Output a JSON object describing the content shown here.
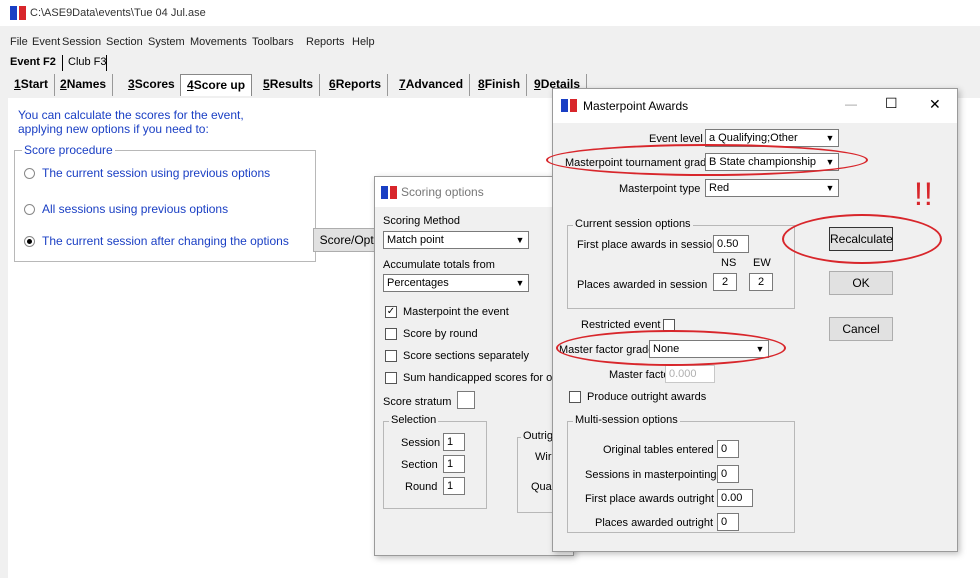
{
  "app": {
    "title": "C:\\ASE9Data\\events\\Tue 04 Jul.ase",
    "menu": [
      "File",
      "Event",
      "Session",
      "Section",
      "System",
      "Movements",
      "Toolbars",
      "Reports",
      "Help"
    ],
    "event_tabs": [
      "Event F2",
      "Club F3"
    ],
    "tabs": [
      {
        "key": "1",
        "label": "Start"
      },
      {
        "key": "2",
        "label": "Names"
      },
      {
        "key": "3",
        "label": "Scores"
      },
      {
        "key": "4",
        "label": "Score up"
      },
      {
        "key": "5",
        "label": "Results"
      },
      {
        "key": "6",
        "label": "Reports"
      },
      {
        "key": "7",
        "label": "Advanced"
      },
      {
        "key": "8",
        "label": "Finish"
      },
      {
        "key": "9",
        "label": "Details"
      }
    ],
    "intro_line1": "You can calculate the scores for the event,",
    "intro_line2": "applying new options if you need to:",
    "procedure_label": "Score procedure",
    "options": [
      "The current session using previous options",
      "All  sessions using previous options",
      "The current session after changing the options"
    ],
    "score_button": "Score/Opti"
  },
  "scoring": {
    "title": "Scoring options",
    "method_label": "Scoring Method",
    "method_value": "Match point",
    "accumulate_label": "Accumulate totals from",
    "accumulate_value": "Percentages",
    "checks": [
      {
        "label": "Masterpoint the event",
        "checked": true
      },
      {
        "label": "Score by round",
        "checked": false
      },
      {
        "label": "Score sections separately",
        "checked": false
      },
      {
        "label": "Sum handicapped scores for out",
        "checked": false
      }
    ],
    "stratum_label": "Score stratum",
    "selection_label": "Selection",
    "session_label": "Session",
    "session_value": "1",
    "section_label": "Section",
    "section_value": "1",
    "round_label": "Round",
    "round_value": "1",
    "outright_label": "Outrigh",
    "win_label": "Wir",
    "quali_label": "Quali"
  },
  "masterpoint": {
    "title": "Masterpoint Awards",
    "event_level_label": "Event level",
    "event_level_value": "a Qualifying;Other",
    "grade_label": "Masterpoint tournament grade",
    "grade_value": "B  State championship",
    "type_label": "Masterpoint type",
    "type_value": "Red",
    "current_group": "Current session options",
    "first_place_label": "First place awards in session",
    "first_place_value": "0.50",
    "ns_label": "NS",
    "ew_label": "EW",
    "places_label": "Places awarded in session",
    "places_ns": "2",
    "places_ew": "2",
    "restricted_label": "Restricted event",
    "factor_grade_label": "Master factor grade",
    "factor_grade_value": "None",
    "factor_label": "Master factor",
    "factor_value": "0.000",
    "outright_label": "Produce outright awards",
    "multi_group": "Multi-session options",
    "orig_tables_label": "Original tables entered",
    "orig_tables_value": "0",
    "sessions_mp_label": "Sessions in masterpointing",
    "sessions_mp_value": "0",
    "first_outright_label": "First place awards outright",
    "first_outright_value": "0.00",
    "places_outright_label": "Places awarded outright",
    "places_outright_value": "0",
    "recalc_button": "Recalculate",
    "ok_button": "OK",
    "cancel_button": "Cancel",
    "minimize": "—",
    "maximize": "☐",
    "close": "✕"
  },
  "annotation": {
    "text": "!!",
    "color": "#d8262b"
  }
}
